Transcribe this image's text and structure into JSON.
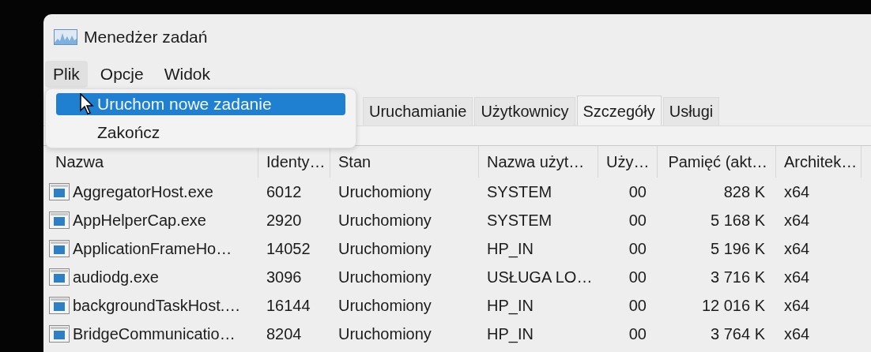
{
  "window": {
    "title": "Menedżer zadań"
  },
  "menu_bar": [
    {
      "label": "Plik",
      "selected": true
    },
    {
      "label": "Opcje",
      "selected": false
    },
    {
      "label": "Widok",
      "selected": false
    }
  ],
  "file_menu": [
    {
      "label": "Uruchom nowe zadanie",
      "selected": true
    },
    {
      "label": "Zakończ",
      "selected": false
    }
  ],
  "tabs": [
    {
      "label": "Uruchamianie",
      "selected": false
    },
    {
      "label": "Użytkownicy",
      "selected": false
    },
    {
      "label": "Szczegóły",
      "selected": true
    },
    {
      "label": "Usługi",
      "selected": false
    }
  ],
  "table": {
    "columns": [
      "Nazwa",
      "Identy…",
      "Stan",
      "Nazwa użyt…",
      "Uży…",
      "Pamięć (akt…",
      "Architek…"
    ],
    "rows": [
      {
        "name": "AggregatorHost.exe",
        "pid": "6012",
        "status": "Uruchomiony",
        "user": "SYSTEM",
        "cpu": "00",
        "memory": "828 K",
        "arch": "x64"
      },
      {
        "name": "AppHelperCap.exe",
        "pid": "2920",
        "status": "Uruchomiony",
        "user": "SYSTEM",
        "cpu": "00",
        "memory": "5 168 K",
        "arch": "x64"
      },
      {
        "name": "ApplicationFrameHo…",
        "pid": "14052",
        "status": "Uruchomiony",
        "user": "HP_IN",
        "cpu": "00",
        "memory": "5 196 K",
        "arch": "x64"
      },
      {
        "name": "audiodg.exe",
        "pid": "3096",
        "status": "Uruchomiony",
        "user": "USŁUGA LO…",
        "cpu": "00",
        "memory": "3 716 K",
        "arch": "x64"
      },
      {
        "name": "backgroundTaskHost.…",
        "pid": "16144",
        "status": "Uruchomiony",
        "user": "HP_IN",
        "cpu": "00",
        "memory": "12 016 K",
        "arch": "x64"
      },
      {
        "name": "BridgeCommunicatio…",
        "pid": "8204",
        "status": "Uruchomiony",
        "user": "HP_IN",
        "cpu": "00",
        "memory": "3 764 K",
        "arch": "x64"
      }
    ]
  }
}
